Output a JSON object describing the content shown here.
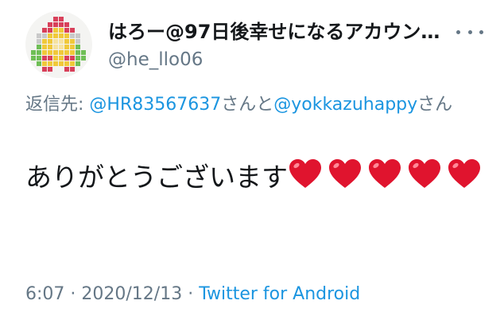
{
  "user": {
    "display_name": "はろー@97日後幸せになるアカウン…",
    "handle": "@he_llo06"
  },
  "reply": {
    "prefix": "返信先: ",
    "mention_1": "@HR83567637",
    "joiner": "さんと",
    "mention_2": "@yokkazuhappy",
    "suffix": "さん"
  },
  "tweet": {
    "text": "ありがとうございます",
    "emoji": [
      "red-heart",
      "red-heart",
      "red-heart",
      "red-heart",
      "red-heart"
    ]
  },
  "meta": {
    "time": "6:07",
    "separator": " · ",
    "date": "2020/12/13",
    "source": "Twitter for Android"
  },
  "colors": {
    "link": "#1b95e0",
    "secondary_text": "#657786",
    "primary_text": "#14171a",
    "heart": "#e0142e"
  }
}
